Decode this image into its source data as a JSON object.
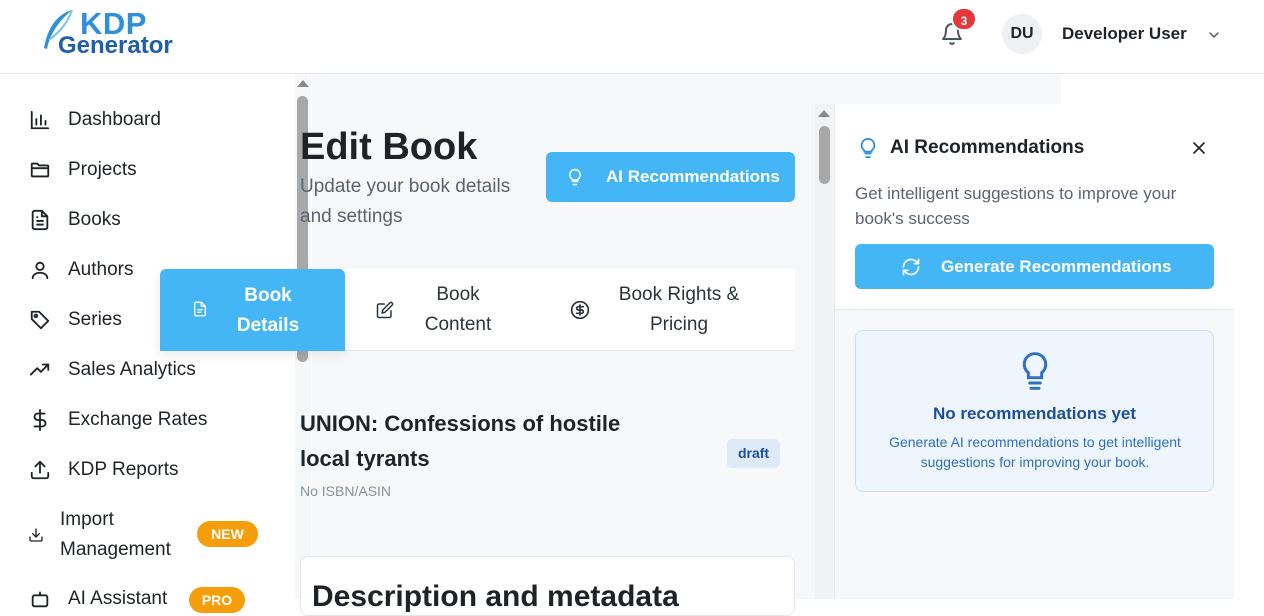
{
  "header": {
    "logo_top": "KDP",
    "logo_bottom": "Generator",
    "notification_count": "3",
    "avatar_initials": "DU",
    "user_name": "Developer User"
  },
  "sidebar": {
    "items": [
      {
        "label": "Dashboard",
        "icon": "bar-chart-icon"
      },
      {
        "label": "Projects",
        "icon": "folder-icon"
      },
      {
        "label": "Books",
        "icon": "document-icon"
      },
      {
        "label": "Authors",
        "icon": "user-icon"
      },
      {
        "label": "Series",
        "icon": "tags-icon"
      },
      {
        "label": "Sales Analytics",
        "icon": "trending-up-icon"
      },
      {
        "label": "Exchange Rates",
        "icon": "dollar-icon"
      },
      {
        "label": "KDP Reports",
        "icon": "upload-icon"
      },
      {
        "label": "Import Management",
        "icon": "download-icon",
        "badge": "NEW"
      },
      {
        "label": "AI Assistant",
        "icon": "bot-icon",
        "badge": "PRO"
      }
    ]
  },
  "main": {
    "title": "Edit Book",
    "subtitle": "Update your book details and settings",
    "ai_button_label": "AI Recommendations",
    "tabs": [
      {
        "label": "Book Details",
        "icon": "file-icon",
        "active": true
      },
      {
        "label": "Book Content",
        "icon": "edit-icon",
        "active": false
      },
      {
        "label": "Book Rights & Pricing",
        "icon": "dollar-circle-icon",
        "active": false
      }
    ],
    "book": {
      "title": "UNION: Confessions of hostile local tyrants",
      "asin": "No ISBN/ASIN",
      "status": "draft"
    },
    "next_section_heading": "Description and metadata"
  },
  "ai_panel": {
    "title": "AI Recommendations",
    "description": "Get intelligent suggestions to improve your book's success",
    "generate_label": "Generate Recommendations",
    "empty_title": "No recommendations yet",
    "empty_description": "Generate AI recommendations to get intelligent suggestions for improving your book."
  },
  "colors": {
    "accent": "#45b6f5",
    "badge_red": "#e5383b",
    "pill_orange": "#f59e0b",
    "info_blue": "#1e4f9a"
  }
}
